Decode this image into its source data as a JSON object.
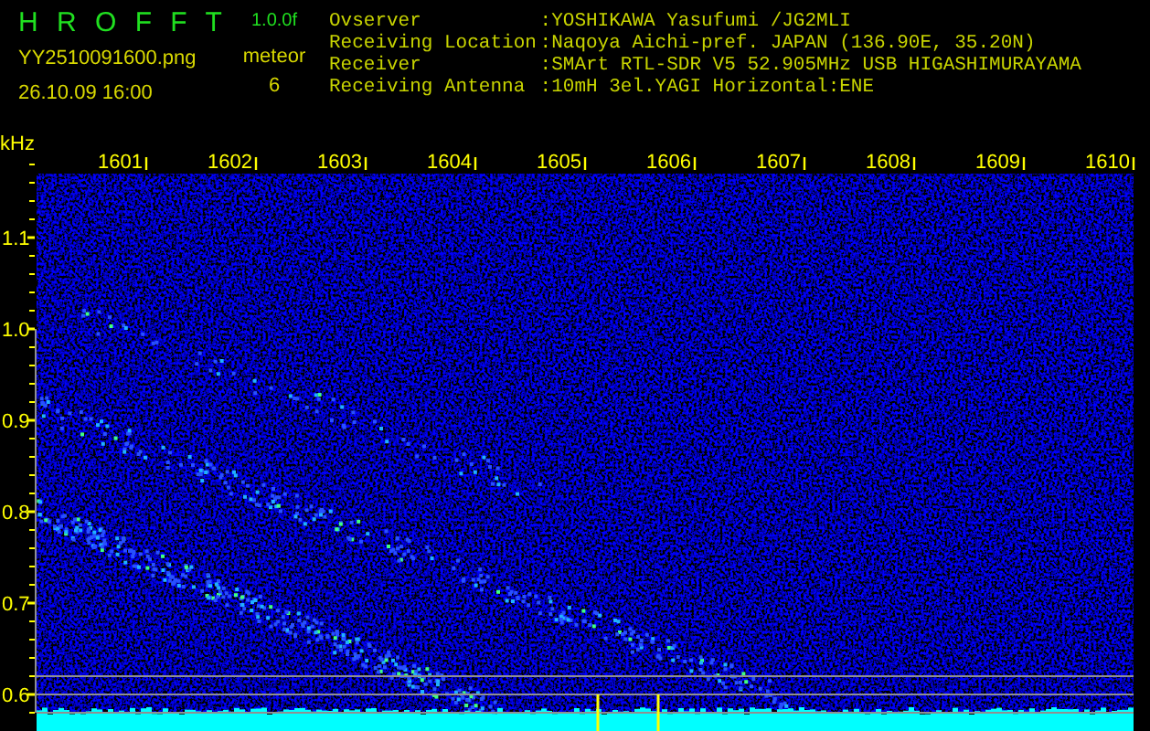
{
  "header": {
    "logo": "H R O F F T",
    "version": "1.0.0f",
    "filename": "YY2510091600.png",
    "datetime": "26.10.09 16:00",
    "meteor_label": "meteor",
    "meteor_count": "6"
  },
  "info": [
    {
      "label": "Ovserver",
      "value": ":YOSHIKAWA Yasufumi /JG2MLI"
    },
    {
      "label": "Receiving Location",
      "value": ":Naqoya Aichi-pref. JAPAN (136.90E, 35.20N)"
    },
    {
      "label": "Receiver",
      "value": ":SMArt RTL-SDR V5 52.905MHz USB HIGASHIMURAYAMA"
    },
    {
      "label": "Receiving Antenna",
      "value": ":10mH 3el.YAGI Horizontal:ENE"
    }
  ],
  "plot": {
    "unit": "kHz",
    "x_labels": [
      "1601",
      "1602",
      "1603",
      "1604",
      "1605",
      "1606",
      "1607",
      "1608",
      "1609",
      "1610"
    ],
    "y_labels": [
      "1.1",
      "1.0",
      "0.9",
      "0.8",
      "0.7",
      "0.6"
    ]
  }
}
